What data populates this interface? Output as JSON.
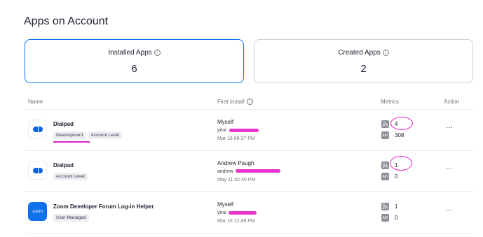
{
  "page": {
    "title": "Apps on Account"
  },
  "cards": [
    {
      "label": "Installed Apps",
      "count": "6"
    },
    {
      "label": "Created Apps",
      "count": "2"
    }
  ],
  "table": {
    "headers": {
      "name": "Name",
      "first_install": "First Install",
      "metrics": "Metrics",
      "action": "Action"
    },
    "rows": [
      {
        "name": "Dialpad",
        "icon": "dialpad-logo",
        "tags": [
          "Development",
          "Account Level"
        ],
        "installer": "Myself",
        "email": "yirui",
        "date": "Mar 16 08:37 PM",
        "metric1": "4",
        "metric2": "308",
        "action": "···"
      },
      {
        "name": "Dialpad",
        "icon": "dialpad-logo",
        "tags": [
          "Account Level"
        ],
        "installer": "Andrew Paugh",
        "email": "andrew",
        "date": "May 11 02:40 PM",
        "metric1": "1",
        "metric2": "0",
        "action": "···"
      },
      {
        "name": "Zoom Developer Forum Log-in Helper",
        "icon": "zoom-logo",
        "icon_text": "zoom",
        "tags": [
          "User Managed"
        ],
        "installer": "Myself",
        "email": "yirui",
        "date": "Mar 16 12:49 PM",
        "metric1": "1",
        "metric2": "0",
        "action": "···"
      }
    ]
  },
  "colors": {
    "accent": "#0e72ed",
    "annotation": "#e61ec6",
    "dialpad": "#0b62e4"
  },
  "metric_icons": [
    "rss-icon",
    "api-icon"
  ],
  "metric_icon_text": {
    "api": "API"
  },
  "info_icon_glyph": "i"
}
